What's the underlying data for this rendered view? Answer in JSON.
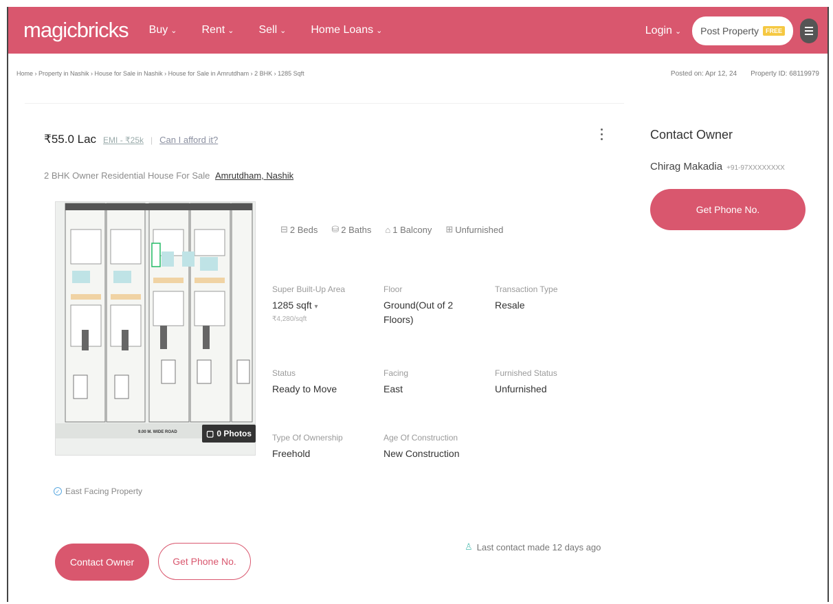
{
  "header": {
    "logo": "magicbricks",
    "nav": [
      {
        "label": "Buy"
      },
      {
        "label": "Rent"
      },
      {
        "label": "Sell"
      },
      {
        "label": "Home Loans"
      }
    ],
    "login_label": "Login",
    "post_property_label": "Post Property",
    "free_badge": "FREE",
    "brand_color": "#d9576e"
  },
  "breadcrumb": "Home › Property in Nashik › House for Sale in Nashik › House for Sale in Amrutdham › 2 BHK › 1285 Sqft",
  "posted_on": "Posted on: Apr 12, 24",
  "property_id": "Property ID: 68119979",
  "listing": {
    "price": "₹55.0 Lac",
    "emi": "EMI - ₹25k",
    "afford": "Can I afford it?",
    "subtitle": "2 BHK Owner Residential House For Sale",
    "location": "Amrutdham, Nashik",
    "photos_badge": "0 Photos",
    "amenities": [
      {
        "icon": "bed-icon",
        "label": "2 Beds"
      },
      {
        "icon": "bath-icon",
        "label": "2 Baths"
      },
      {
        "icon": "balcony-icon",
        "label": "1 Balcony"
      },
      {
        "icon": "furnish-icon",
        "label": "Unfurnished"
      }
    ],
    "details": {
      "area_label": "Super Built-Up Area",
      "area_value": "1285 sqft",
      "area_rate": "₹4,280/sqft",
      "floor_label": "Floor",
      "floor_value": "Ground(Out of 2 Floors)",
      "transaction_label": "Transaction Type",
      "transaction_value": "Resale",
      "status_label": "Status",
      "status_value": "Ready to Move",
      "facing_label": "Facing",
      "facing_value": "East",
      "furnished_label": "Furnished Status",
      "furnished_value": "Unfurnished",
      "ownership_label": "Type Of Ownership",
      "ownership_value": "Freehold",
      "age_label": "Age Of Construction",
      "age_value": "New Construction"
    },
    "highlight": "East Facing Property",
    "contact_owner_btn": "Contact Owner",
    "get_phone_btn": "Get Phone No.",
    "last_contact": "Last contact made 12 days ago",
    "plan_road_label": "9.00 M. WIDE ROAD"
  },
  "sidebar": {
    "title": "Contact Owner",
    "owner_name": "Chirag Makadia",
    "owner_phone": "+91-97XXXXXXXX",
    "button": "Get Phone No."
  }
}
